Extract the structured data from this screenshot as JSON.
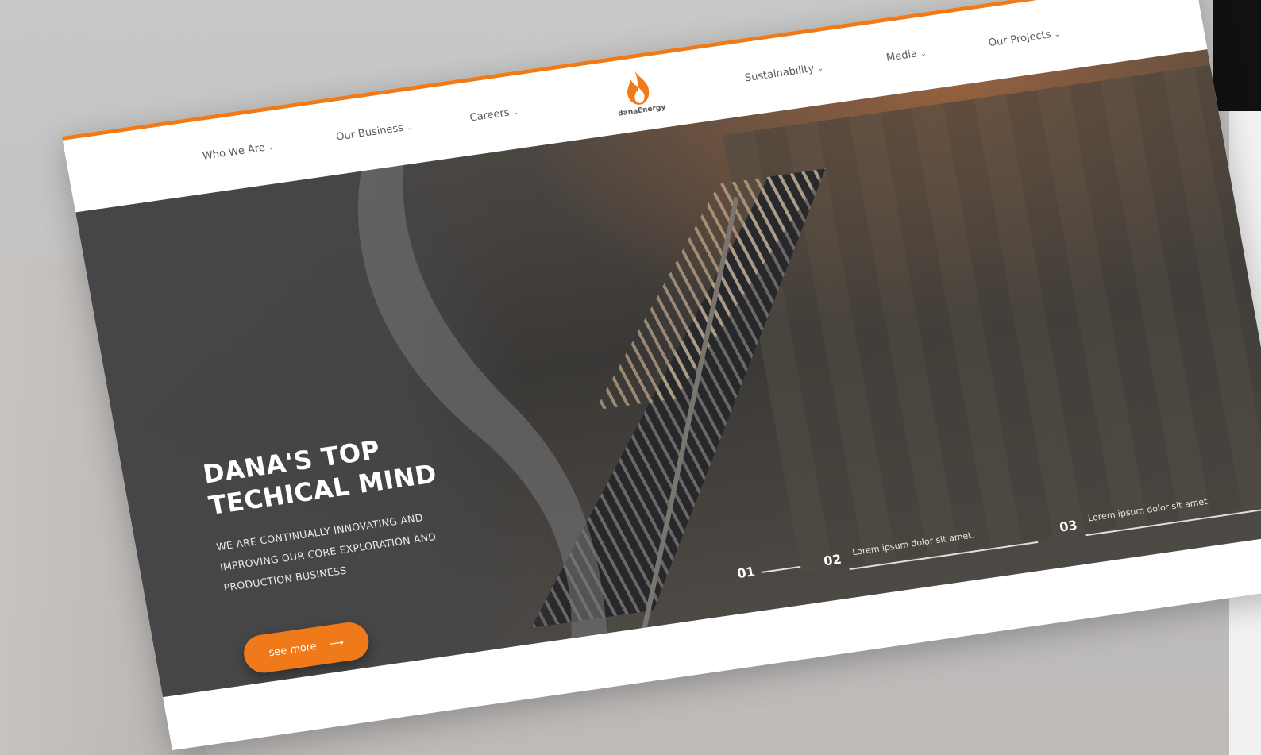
{
  "nav": {
    "items": [
      {
        "label": "Who We Are"
      },
      {
        "label": "Our Business"
      },
      {
        "label": "Careers"
      },
      {
        "label": "Sustainability"
      },
      {
        "label": "Media"
      },
      {
        "label": "Our Projects"
      }
    ],
    "chevron": "⌄",
    "logo_text": "danaEnergy"
  },
  "hero": {
    "title_line1": "DANA'S TOP",
    "title_line2": "TECHICAL MIND",
    "subtitle": "WE ARE CONTINUALLY INNOVATING AND IMPROVING OUR CORE EXPLORATION AND PRODUCTION BUSINESS",
    "cta_label": "see more",
    "cta_arrow": "⟶"
  },
  "slides": [
    {
      "number": "01",
      "text": ""
    },
    {
      "number": "02",
      "text": "Lorem ipsum dolor sit amet."
    },
    {
      "number": "03",
      "text": "Lorem ipsum dolor sit amet."
    }
  ],
  "colors": {
    "accent": "#f07a1a",
    "backdrop": "#c6c6c6",
    "nav_text": "#5a5a5a"
  },
  "icons": {
    "logo": "flame-icon",
    "cta": "arrow-right-icon",
    "nav": "chevron-down-icon"
  }
}
